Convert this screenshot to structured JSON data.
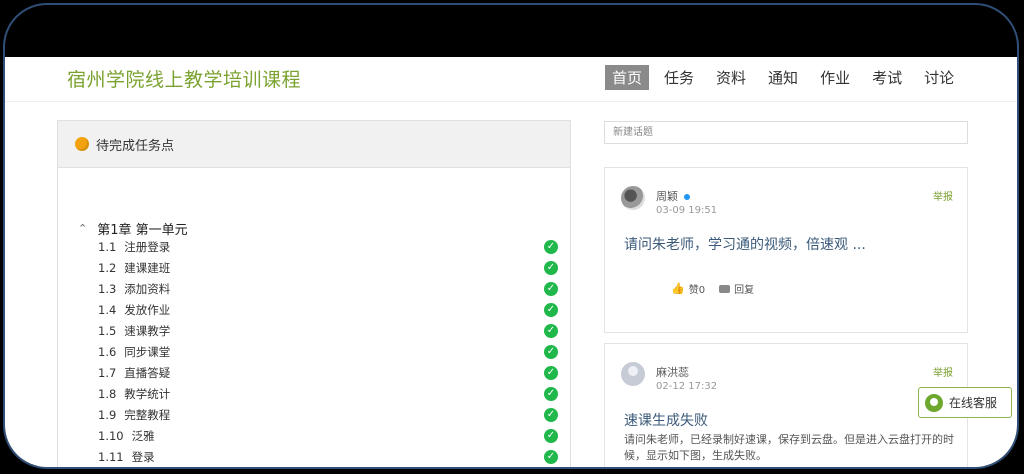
{
  "site_title": "宿州学院线上教学培训课程",
  "nav": [
    "首页",
    "任务",
    "资料",
    "通知",
    "作业",
    "考试",
    "讨论"
  ],
  "tasks": {
    "title": "待完成任务点",
    "chapter": "第1章 第一单元",
    "lessons": [
      {
        "num": "1.1",
        "name": "注册登录"
      },
      {
        "num": "1.2",
        "name": "建课建班"
      },
      {
        "num": "1.3",
        "name": "添加资料"
      },
      {
        "num": "1.4",
        "name": "发放作业"
      },
      {
        "num": "1.5",
        "name": "速课教学"
      },
      {
        "num": "1.6",
        "name": "同步课堂"
      },
      {
        "num": "1.7",
        "name": "直播答疑"
      },
      {
        "num": "1.8",
        "name": "教学统计"
      },
      {
        "num": "1.9",
        "name": "完整教程"
      },
      {
        "num": "1.10",
        "name": "泛雅"
      },
      {
        "num": "1.11",
        "name": "登录"
      }
    ]
  },
  "discussion": {
    "new_topic_placeholder": "新建话题",
    "posts": [
      {
        "author": "周颖",
        "time": "03-09 19:51",
        "report": "举报",
        "title": "请问朱老师，学习通的视频，倍速观 ...",
        "like": "赞0",
        "reply": "回复"
      },
      {
        "author": "麻洪蕊",
        "time": "02-12 17:32",
        "report": "举报",
        "title": "速课生成失败",
        "excerpt": "请问朱老师，已经录制好速课，保存到云盘。但是进入云盘打开的时候，显示如下图，生成失败。"
      }
    ]
  },
  "service_label": "在线客服"
}
